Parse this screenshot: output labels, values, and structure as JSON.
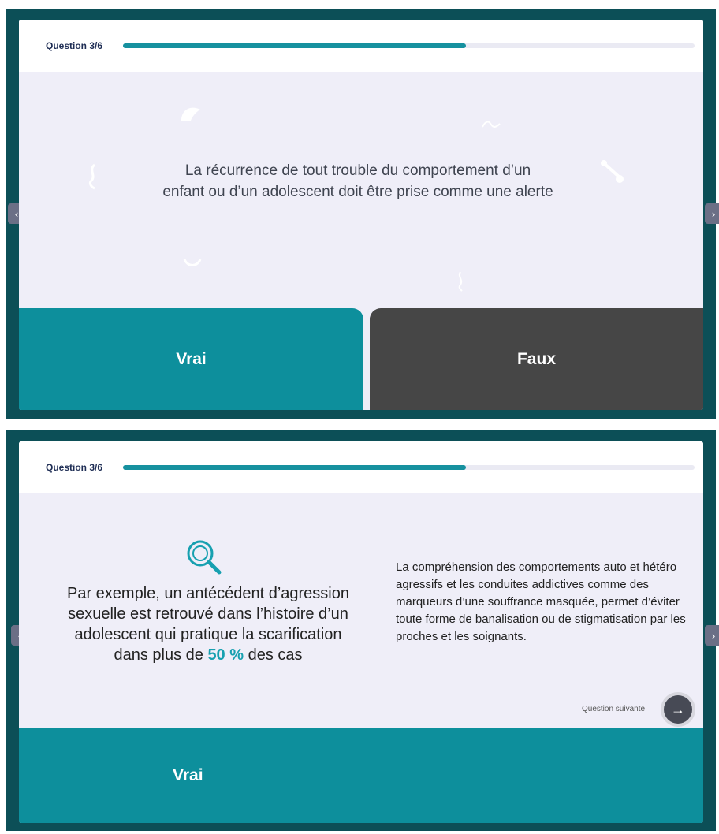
{
  "slide1": {
    "question_label": "Question 3/6",
    "progress": 0.6,
    "question_line1": "La récurrence de tout trouble du comportement d’un",
    "question_line2": "enfant ou d’un adolescent doit être prise comme une alerte",
    "true_label": "Vrai",
    "false_label": "Faux",
    "prev_arrow": "‹",
    "next_arrow": "›"
  },
  "slide2": {
    "question_label": "Question 3/6",
    "progress": 0.6,
    "fact_text": "Par exemple, un antécédent d’agression sexuelle est retrouvé dans l’histoire d’un adolescent qui pratique la scarification dans plus de",
    "fact_highlight": "50 %",
    "fact_suffix": "des cas",
    "explanation": "La compréhension des comportements auto et hétéro agressifs et les conduites addictives comme des marqueurs d’une souffrance masquée, permet d’éviter toute forme de banalisation ou de stigmatisation par les proches et les soignants.",
    "next_label": "Question suivante",
    "next_icon": "→",
    "answer_label": "Vrai",
    "prev_arrow": "‹",
    "next_arrow": "›"
  },
  "colors": {
    "frame": "#0c4f57",
    "teal": "#0d8f9c",
    "dark": "#464646",
    "highlight": "#17a0b0"
  }
}
